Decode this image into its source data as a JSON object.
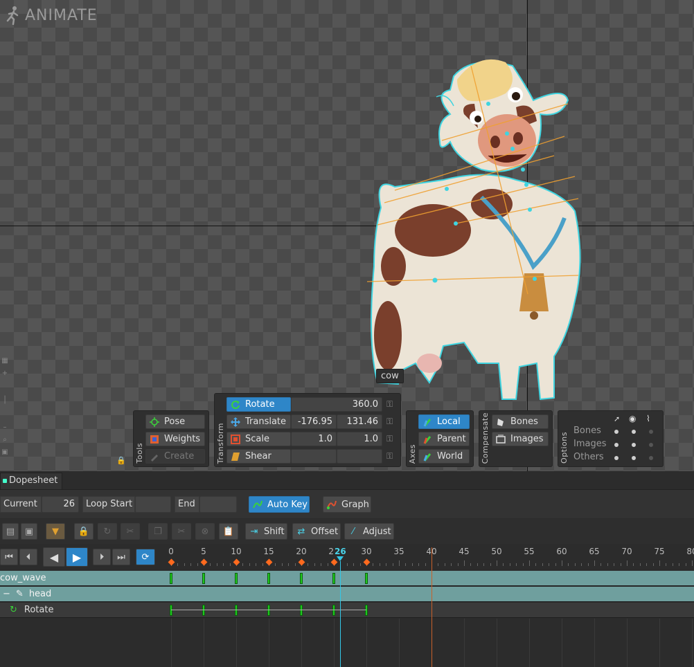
{
  "app": {
    "title": "ANIMATE"
  },
  "viewport": {
    "tooltip": "cow"
  },
  "tools": {
    "label": "Tools",
    "buttons": [
      {
        "label": "Pose",
        "icon": "pose-icon"
      },
      {
        "label": "Weights",
        "icon": "weights-icon"
      },
      {
        "label": "Create",
        "icon": "create-icon",
        "disabled": true
      }
    ]
  },
  "transform": {
    "label": "Transform",
    "rows": [
      {
        "label": "Rotate",
        "icon": "rotate-icon",
        "active": true,
        "value1": "",
        "value2": "360.0"
      },
      {
        "label": "Translate",
        "icon": "translate-icon",
        "value1": "-176.95",
        "value2": "131.46"
      },
      {
        "label": "Scale",
        "icon": "scale-icon",
        "value1": "1.0",
        "value2": "1.0"
      },
      {
        "label": "Shear",
        "icon": "shear-icon",
        "value1": "",
        "value2": ""
      }
    ]
  },
  "axes": {
    "label": "Axes",
    "buttons": [
      {
        "label": "Local",
        "active": true
      },
      {
        "label": "Parent"
      },
      {
        "label": "World"
      }
    ]
  },
  "compensate": {
    "label": "Compensate",
    "buttons": [
      {
        "label": "Bones"
      },
      {
        "label": "Images"
      }
    ]
  },
  "options": {
    "label": "Options",
    "rows": [
      {
        "label": "Bones"
      },
      {
        "label": "Images"
      },
      {
        "label": "Others"
      }
    ]
  },
  "dopesheet": {
    "tab": "Dopesheet",
    "current_label": "Current",
    "current_value": "26",
    "loop_start_label": "Loop Start",
    "loop_start_value": "",
    "end_label": "End",
    "end_value": "",
    "auto_key_label": "Auto Key",
    "graph_label": "Graph",
    "shift_label": "Shift",
    "offset_label": "Offset",
    "adjust_label": "Adjust",
    "ruler_ticks": [
      "0",
      "5",
      "10",
      "15",
      "20",
      "25",
      "30",
      "35",
      "40",
      "45",
      "50",
      "55",
      "60",
      "65",
      "70",
      "75",
      "80"
    ],
    "playhead_label": "26",
    "tracks": [
      {
        "name": "cow_wave"
      },
      {
        "name": "head"
      },
      {
        "name": "Rotate"
      }
    ],
    "keyframes": [
      0,
      5,
      10,
      15,
      20,
      25,
      30
    ],
    "playhead_frame": 26,
    "loop_end_frame": 40
  },
  "colors": {
    "accent": "#2e86c8",
    "key_green": "#1ec81e",
    "key_orange": "#ff6a1e",
    "bone_cyan": "#3fd4e0",
    "playhead": "#33c8e8"
  }
}
